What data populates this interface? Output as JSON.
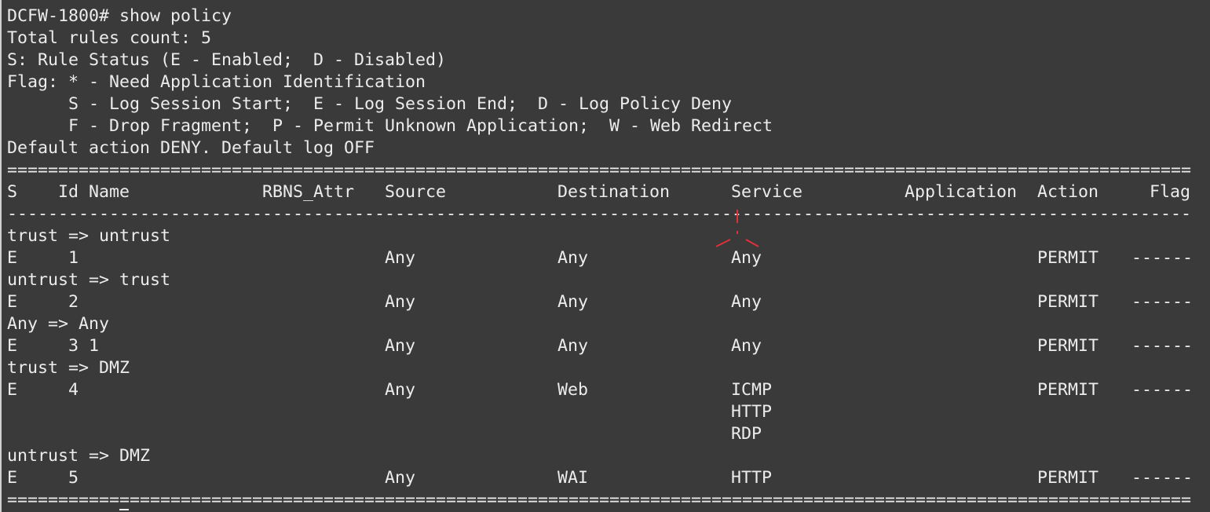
{
  "terminal": {
    "prompt_line": "DCFW-1800# show policy",
    "header_lines": [
      "Total rules count: 5",
      "S: Rule Status (E - Enabled;  D - Disabled)",
      "Flag: * - Need Application Identification",
      "      S - Log Session Start;  E - Log Session End;  D - Log Policy Deny",
      "      F - Drop Fragment;  P - Permit Unknown Application;  W - Web Redirect",
      "Default action DENY. Default log OFF"
    ],
    "double_separator": "==================================================================================================================================================",
    "single_separator": "--------------------------------------------------------------------------------------------------------------------------------------------------",
    "columns": {
      "s": "S",
      "id": "Id",
      "name": "Name",
      "rbns": "RBNS_Attr",
      "source": "Source",
      "destination": "Destination",
      "service": "Service",
      "application": "Application",
      "action": "Action",
      "flag": "Flag"
    },
    "groups": [
      {
        "zone": "trust => untrust",
        "rule": {
          "s": "E",
          "id": "1",
          "source": "Any",
          "destination": "Any",
          "services": [
            "Any"
          ],
          "action": "PERMIT",
          "flag": "------"
        }
      },
      {
        "zone": "untrust => trust",
        "rule": {
          "s": "E",
          "id": "2",
          "source": "Any",
          "destination": "Any",
          "services": [
            "Any"
          ],
          "action": "PERMIT",
          "flag": "------"
        }
      },
      {
        "zone": "Any => Any",
        "rule": {
          "s": "E",
          "id": "3 1",
          "source": "Any",
          "destination": "Any",
          "services": [
            "Any"
          ],
          "action": "PERMIT",
          "flag": "------"
        }
      },
      {
        "zone": "trust => DMZ",
        "rule": {
          "s": "E",
          "id": "4",
          "source": "Any",
          "destination": "Web",
          "services": [
            "ICMP",
            "HTTP",
            "RDP"
          ],
          "action": "PERMIT",
          "flag": "------"
        }
      },
      {
        "zone": "untrust => DMZ",
        "rule": {
          "s": "E",
          "id": "5",
          "source": "Any",
          "destination": "WAI",
          "services": [
            "HTTP"
          ],
          "action": "PERMIT",
          "flag": "------"
        }
      }
    ],
    "accent_color": "#e0303a"
  }
}
